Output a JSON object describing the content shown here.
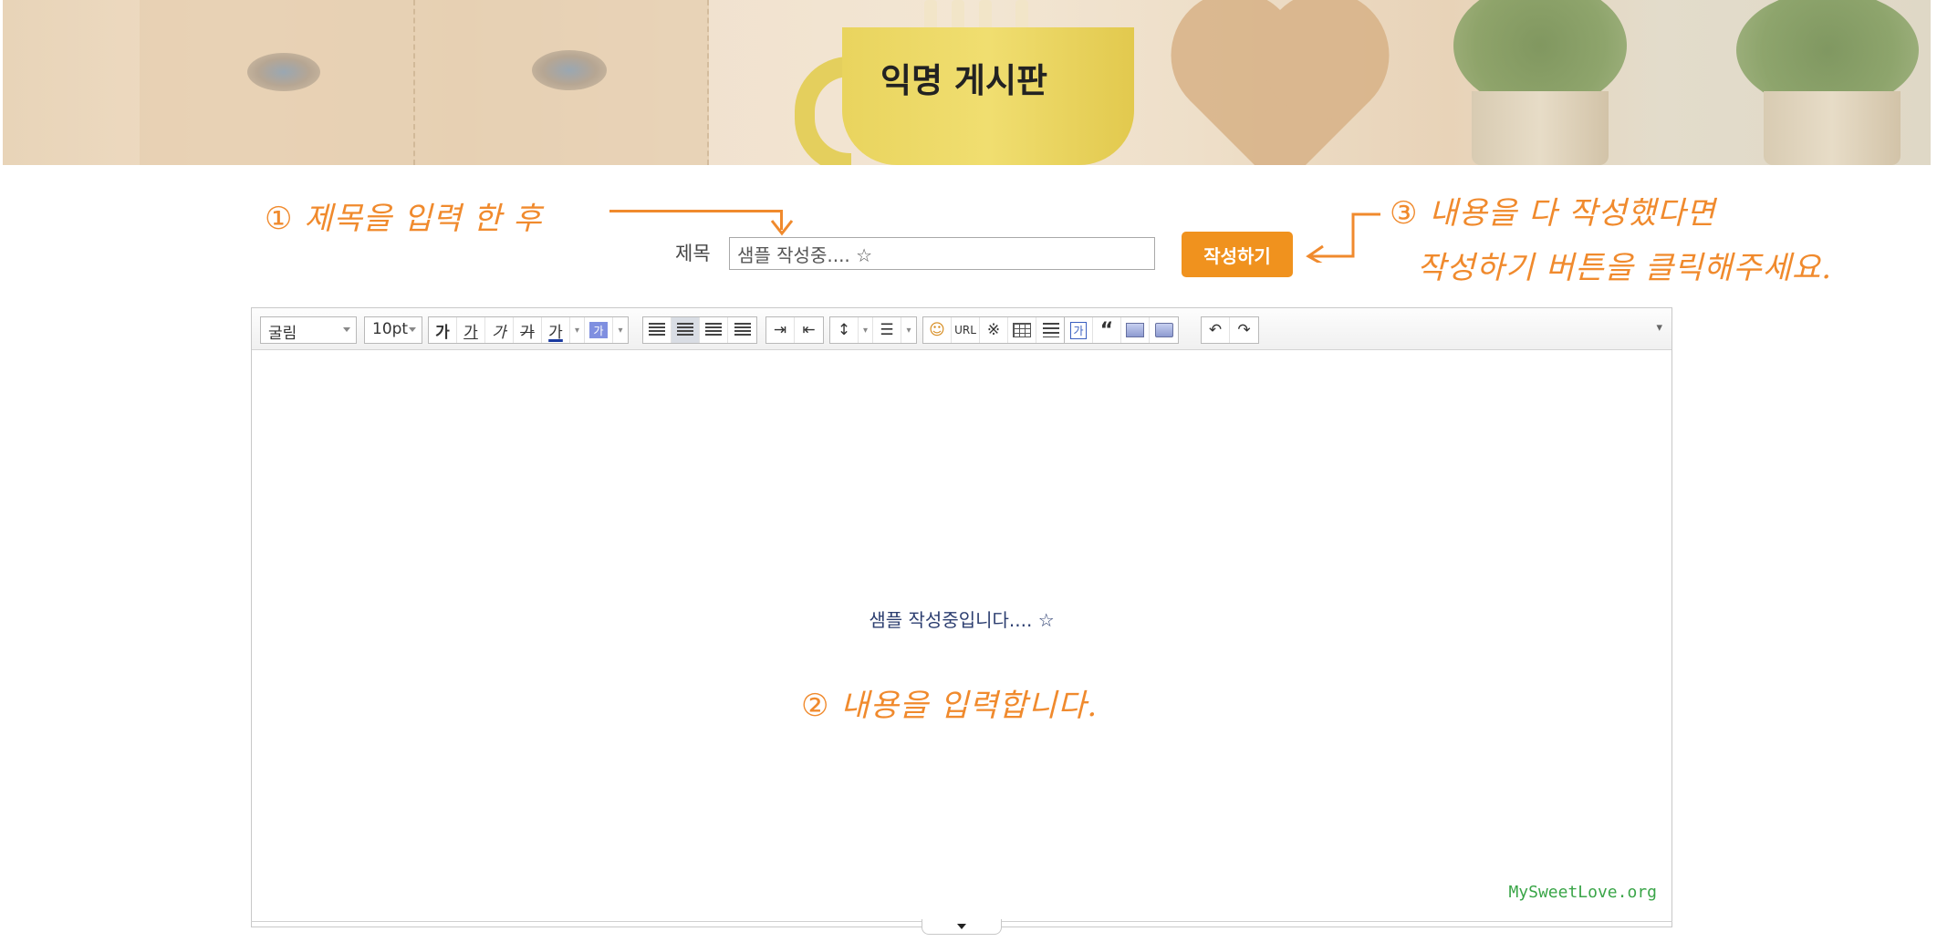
{
  "banner": {
    "title": "익명 게시판"
  },
  "annotations": {
    "step1_num": "①",
    "step1_text": "제목을 입력 한 후",
    "step2_num": "②",
    "step2_text": "내용을 입력합니다.",
    "step3_num": "③",
    "step3_line1": "내용을 다 작성했다면",
    "step3_line2": "작성하기 버튼을 클릭해주세요."
  },
  "form": {
    "title_label": "제목",
    "title_value": "샘플 작성중.... ☆",
    "submit_label": "작성하기"
  },
  "toolbar": {
    "font_family": "굴림",
    "font_size": "10pt",
    "bold": "가",
    "underline": "가",
    "italic": "가",
    "strike": "가",
    "font_color": "가",
    "bg_color": "가",
    "url": "URL",
    "special_char": "※",
    "text_box": "가",
    "quote": "“",
    "more": "▾"
  },
  "editor": {
    "content": "샘플 작성중입니다.... ☆",
    "watermark": "MySweetLove.org"
  },
  "colors": {
    "accent": "#f0921e",
    "annotation": "#f08a2d",
    "watermark": "#3aa548"
  }
}
